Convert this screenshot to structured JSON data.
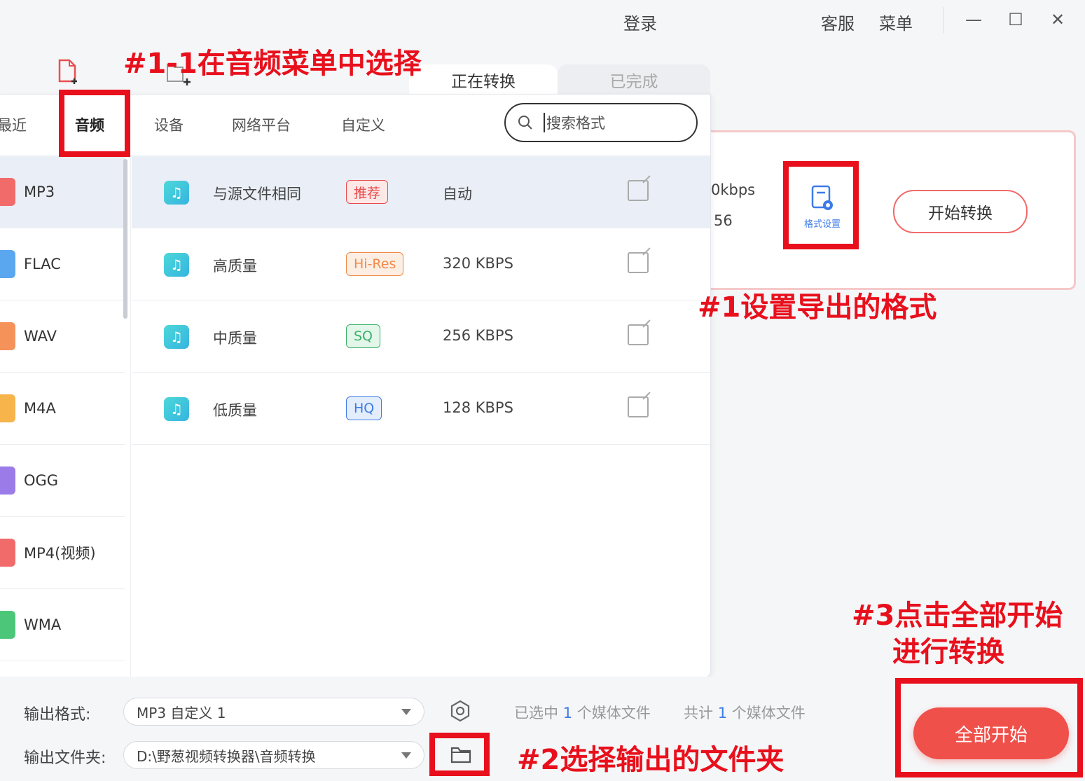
{
  "titlebar": {
    "login": "登录",
    "service": "客服",
    "menu": "菜单",
    "minimize": "—",
    "maximize": "☐",
    "close": "✕"
  },
  "conversion_tabs": {
    "converting": "正在转换",
    "completed": "已完成"
  },
  "format_popup": {
    "categories": [
      "最近",
      "音频",
      "设备",
      "网络平台",
      "自定义"
    ],
    "active_category": "音频",
    "search_placeholder": "搜索格式",
    "formats": [
      {
        "label": "MP3",
        "color": "#f26b6b"
      },
      {
        "label": "FLAC",
        "color": "#5aa7f0"
      },
      {
        "label": "WAV",
        "color": "#f5925a"
      },
      {
        "label": "M4A",
        "color": "#f6b44a"
      },
      {
        "label": "OGG",
        "color": "#9b7be8"
      },
      {
        "label": "MP4(视频)",
        "color": "#f26b6b"
      },
      {
        "label": "WMA",
        "color": "#4cc77a"
      }
    ],
    "presets": [
      {
        "name": "与源文件相同",
        "badge": "推荐",
        "badge_color": "#e84a4a",
        "badge_bg": "#fde8e8",
        "value": "自动"
      },
      {
        "name": "高质量",
        "badge": "Hi-Res",
        "badge_color": "#f08a4a",
        "badge_bg": "#fdeee3",
        "value": "320 KBPS"
      },
      {
        "name": "中质量",
        "badge": "SQ",
        "badge_color": "#3cb06a",
        "badge_bg": "#e3f6ea",
        "value": "256 KBPS"
      },
      {
        "name": "低质量",
        "badge": "HQ",
        "badge_color": "#3d7be8",
        "badge_bg": "#e4edfc",
        "value": "128 KBPS"
      }
    ]
  },
  "file_card": {
    "bitrate_partial": "0kbps",
    "size_partial": "56",
    "format_settings": "格式设置",
    "start_convert": "开始转换"
  },
  "bottom": {
    "output_format_label": "输出格式:",
    "output_format_value": "MP3 自定义 1",
    "output_folder_label": "输出文件夹:",
    "output_folder_value": "D:\\野葱视频转换器\\音频转换",
    "selected_prefix": "已选中",
    "selected_count": "1",
    "selected_suffix": "个媒体文件",
    "total_prefix": "共计",
    "total_count": "1",
    "total_suffix": "个媒体文件",
    "start_all": "全部开始"
  },
  "annotations": {
    "step_1_1": "#1-1在音频菜单中选择",
    "step_1": "#1设置导出的格式",
    "step_2": "#2选择输出的文件夹",
    "step_3_line1": "#3点击全部开始",
    "step_3_line2": "进行转换"
  },
  "colors": {
    "accent_red": "#e8101c",
    "start_button": "#f0504a",
    "link_blue": "#3d7be8"
  }
}
